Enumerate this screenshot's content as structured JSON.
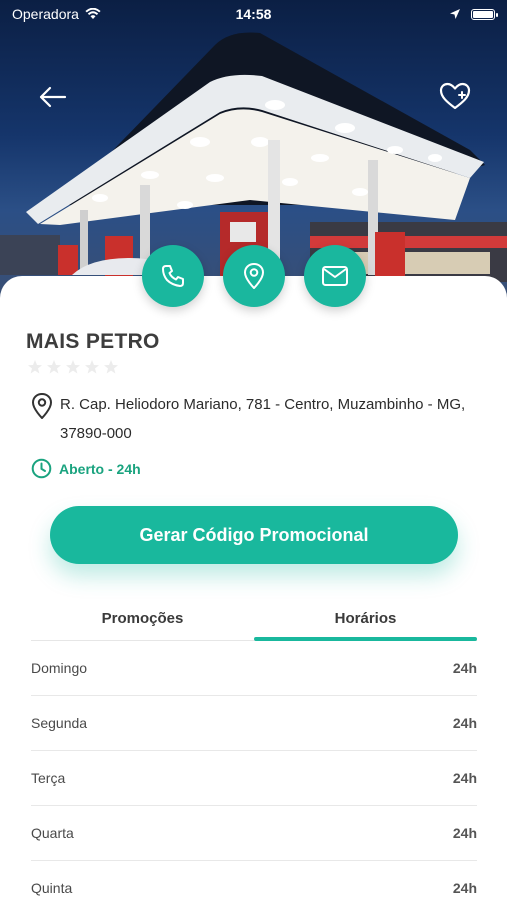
{
  "status_bar": {
    "carrier": "Operadora",
    "time": "14:58"
  },
  "station": {
    "name": "MAIS PETRO",
    "rating": 0,
    "max_rating": 5,
    "address": "R. Cap. Heliodoro Mariano, 781 - Centro, Muzambinho - MG, 37890-000",
    "open_status": "Aberto - 24h"
  },
  "actions": {
    "promo_button": "Gerar Código Promocional"
  },
  "tabs": [
    {
      "label": "Promoções",
      "active": false
    },
    {
      "label": "Horários",
      "active": true
    }
  ],
  "hours": [
    {
      "day": "Domingo",
      "time": "24h"
    },
    {
      "day": "Segunda",
      "time": "24h"
    },
    {
      "day": "Terça",
      "time": "24h"
    },
    {
      "day": "Quarta",
      "time": "24h"
    },
    {
      "day": "Quinta",
      "time": "24h"
    }
  ],
  "colors": {
    "accent": "#19b89d",
    "open_text": "#1aa37f"
  }
}
